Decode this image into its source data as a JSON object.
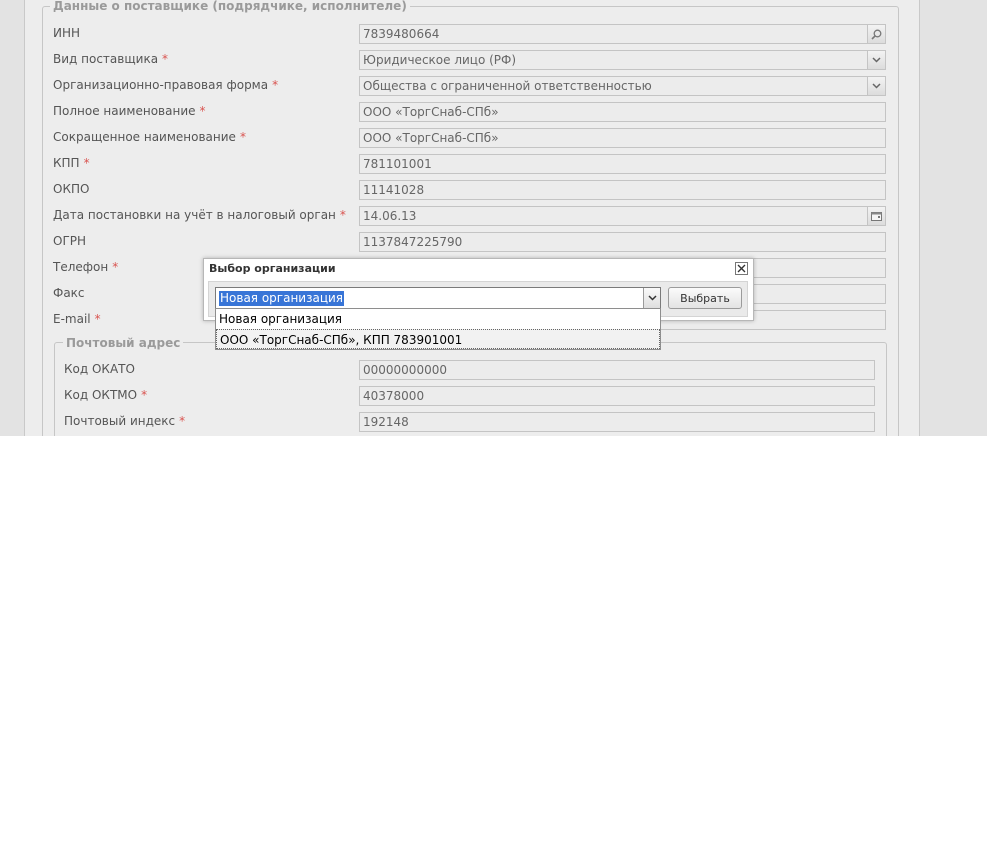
{
  "form": {
    "legend": "Данные о поставщике (подрядчике, исполнителе)",
    "fields": [
      {
        "label": "ИНН",
        "required": false,
        "value": "7839480664",
        "trigger": "search-icon"
      },
      {
        "label": "Вид поставщика",
        "required": true,
        "value": "Юридическое лицо (РФ)",
        "trigger": "chevron-down-icon"
      },
      {
        "label": "Организационно-правовая форма",
        "required": true,
        "value": "Общества с ограниченной ответственностью",
        "trigger": "chevron-down-icon"
      },
      {
        "label": "Полное наименование",
        "required": true,
        "value": "ООО «ТоргСнаб-СПб»"
      },
      {
        "label": "Сокращенное наименование",
        "required": true,
        "value": "ООО «ТоргСнаб-СПб»"
      },
      {
        "label": "КПП",
        "required": true,
        "value": "781101001"
      },
      {
        "label": "ОКПО",
        "required": false,
        "value": "11141028"
      },
      {
        "label": "Дата постановки на учёт в налоговый орган",
        "required": true,
        "value": "14.06.13",
        "trigger": "calendar-icon"
      },
      {
        "label": "ОГРН",
        "required": false,
        "value": "1137847225790"
      },
      {
        "label": "Телефон",
        "required": true,
        "value": ""
      },
      {
        "label": "Факс",
        "required": false,
        "value": ""
      },
      {
        "label": "E-mail",
        "required": true,
        "value": ""
      }
    ],
    "required_mark": "*"
  },
  "postal": {
    "legend": "Почтовый адрес",
    "fields": [
      {
        "label": "Код ОКАТО",
        "required": false,
        "value": "00000000000"
      },
      {
        "label": "Код ОКТМО",
        "required": true,
        "value": "40378000"
      },
      {
        "label": "Почтовый индекс",
        "required": true,
        "value": "192148"
      }
    ]
  },
  "modal": {
    "title": "Выбор организации",
    "combo_value": "Новая организация",
    "select_button": "Выбрать",
    "options": [
      "Новая организация",
      "ООО «ТоргСнаб-СПб», КПП 783901001"
    ],
    "highlighted_option": 1
  },
  "colors": {
    "required": "#d9534f",
    "selection": "#3875d7"
  }
}
